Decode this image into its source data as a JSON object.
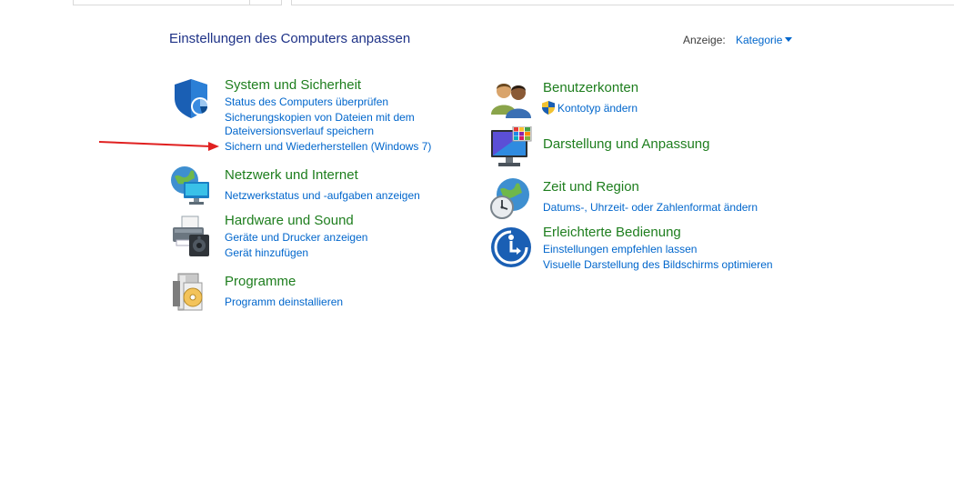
{
  "header": {
    "title": "Einstellungen des Computers anpassen",
    "view_label": "Anzeige:",
    "view_value": "Kategorie"
  },
  "categories": [
    {
      "title": "System und Sicherheit",
      "icon": "shield-icon",
      "links": [
        "Status des Computers überprüfen",
        "Sicherungskopien von Dateien mit dem",
        "Dateiversionsverlauf speichern",
        "Sichern und Wiederherstellen (Windows 7)"
      ]
    },
    {
      "title": "Netzwerk und Internet",
      "icon": "network-globe-icon",
      "links": [
        "Netzwerkstatus und -aufgaben anzeigen"
      ]
    },
    {
      "title": "Hardware und Sound",
      "icon": "printer-speaker-icon",
      "links": [
        "Geräte und Drucker anzeigen",
        "Gerät hinzufügen"
      ]
    },
    {
      "title": "Programme",
      "icon": "programs-disc-icon",
      "links": [
        "Programm deinstallieren"
      ]
    },
    {
      "title": "Benutzerkonten",
      "icon": "users-icon",
      "links": [
        "Kontotyp ändern"
      ]
    },
    {
      "title": "Darstellung und Anpassung",
      "icon": "monitor-palette-icon",
      "links": []
    },
    {
      "title": "Zeit und Region",
      "icon": "clock-globe-icon",
      "links": [
        "Datums-, Uhrzeit- oder Zahlenformat ändern"
      ]
    },
    {
      "title": "Erleichterte Bedienung",
      "icon": "ease-of-access-icon",
      "links": [
        "Einstellungen empfehlen lassen",
        "Visuelle Darstellung des Bildschirms optimieren"
      ]
    }
  ],
  "colors": {
    "category_title": "#1e7e1e",
    "link": "#0066cc",
    "page_title": "#1e3287",
    "annotation_arrow": "#e02020"
  }
}
